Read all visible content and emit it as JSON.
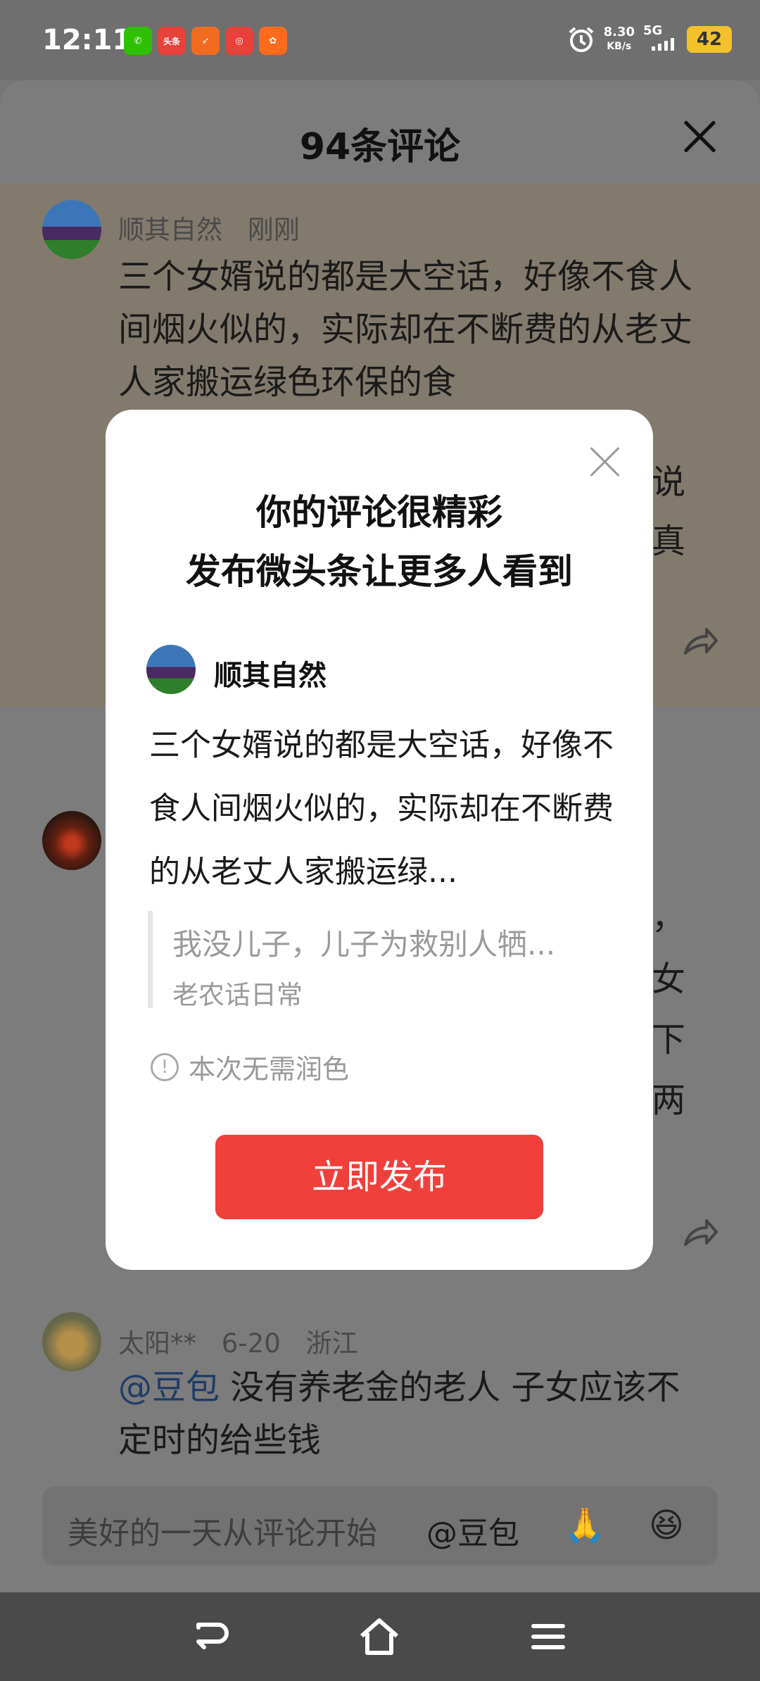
{
  "status_bar": {
    "time": "12:11",
    "app_icons": [
      {
        "name": "wechat-icon",
        "color": "#2dc100",
        "glyph": "✆"
      },
      {
        "name": "toutiao-icon",
        "color": "#e8403a",
        "glyph": "头条"
      },
      {
        "name": "send-app-icon",
        "color": "#f26b21",
        "glyph": "➶"
      },
      {
        "name": "red-app-icon",
        "color": "#e8403a",
        "glyph": "◎"
      },
      {
        "name": "orange-app-icon",
        "color": "#ff6a1c",
        "glyph": "✿"
      }
    ],
    "net_speed": "8.30",
    "net_unit": "KB/s",
    "network": "5G",
    "battery": "42"
  },
  "sheet": {
    "title": "94条评论",
    "comments": [
      {
        "user": "顺其自然",
        "time": "刚刚",
        "text": "三个女婿说的都是大空话，好像不食人间烟火似的，实际却在不断费的从老丈人家搬运绿色环保的食"
      },
      {
        "partial_lines": [
          "，",
          "女",
          "下",
          "两"
        ]
      },
      {
        "user": "太阳**",
        "time": "6-20",
        "location": "浙江",
        "mention": "@豆包",
        "text": " 没有养老金的老人  子女应该不定时的给些钱"
      }
    ],
    "comment1_right_fragments": [
      "说",
      "真"
    ],
    "input_placeholder": "美好的一天从评论开始",
    "input_mention": "@豆包",
    "emoji_1": "🙏",
    "emoji_2": "😆"
  },
  "modal": {
    "title_line1": "你的评论很精彩",
    "title_line2": "发布微头条让更多人看到",
    "user": "顺其自然",
    "text": "三个女婿说的都是大空话，好像不食人间烟火似的，实际却在不断费的从老丈人家搬运绿...",
    "quote_text": "我没儿子，儿子为救别人牺...",
    "quote_source": "老农话日常",
    "hint": "本次无需润色",
    "publish_label": "立即发布",
    "accent_color": "#f13f3c"
  }
}
